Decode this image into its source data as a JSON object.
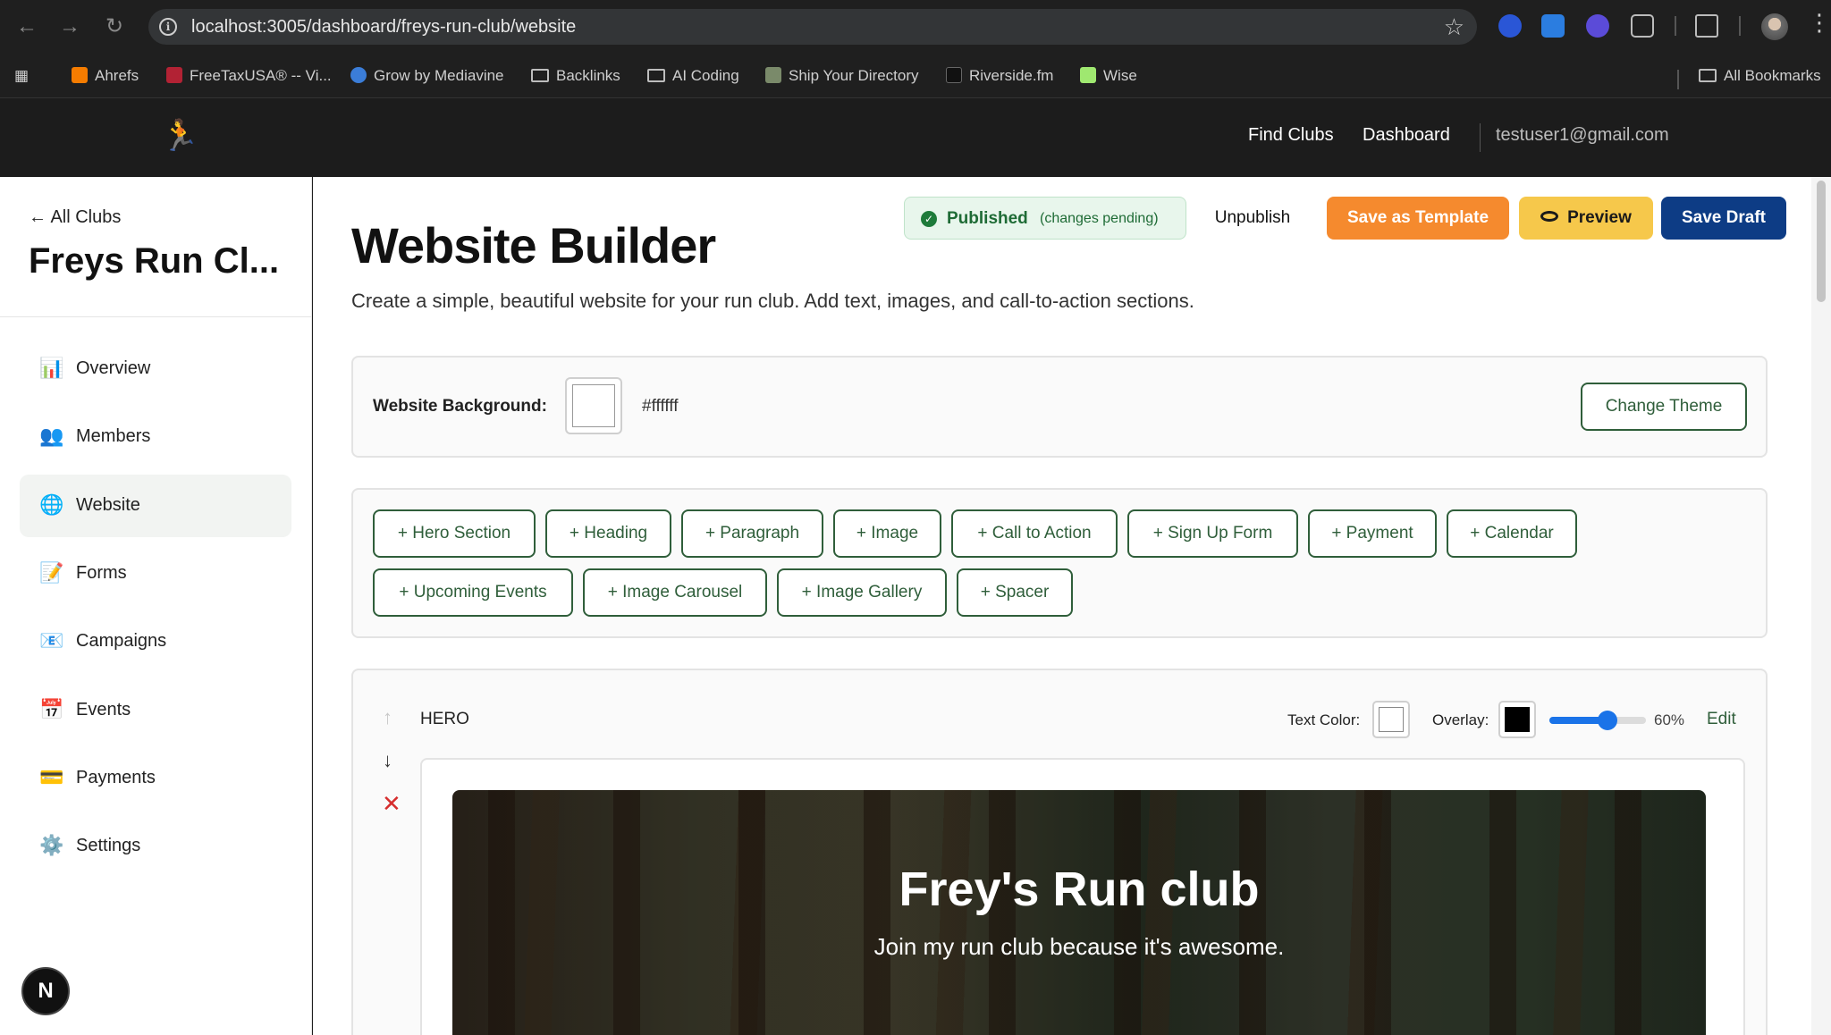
{
  "browser": {
    "url": "localhost:3005/dashboard/freys-run-club/website",
    "bookmarks": [
      "Ahrefs",
      "FreeTaxUSA® -- Vi...",
      "Grow by Mediavine",
      "Backlinks",
      "AI Coding",
      "Ship Your Directory",
      "Riverside.fm",
      "Wise"
    ],
    "all_bookmarks": "All Bookmarks"
  },
  "header": {
    "nav": [
      "Find Clubs",
      "Dashboard"
    ],
    "user_email": "testuser1@gmail.com"
  },
  "sidebar": {
    "back_label": "← All Clubs",
    "club_name": "Freys Run Cl...",
    "items": [
      {
        "label": "Overview",
        "icon": "📊"
      },
      {
        "label": "Members",
        "icon": "👥"
      },
      {
        "label": "Website",
        "icon": "🌐"
      },
      {
        "label": "Forms",
        "icon": "📝"
      },
      {
        "label": "Campaigns",
        "icon": "📧"
      },
      {
        "label": "Events",
        "icon": "📅"
      },
      {
        "label": "Payments",
        "icon": "💳"
      },
      {
        "label": "Settings",
        "icon": "⚙️"
      }
    ],
    "active": "Website",
    "badge": "N"
  },
  "main": {
    "title": "Website Builder",
    "description": "Create a simple, beautiful website for your run club. Add text, images, and call-to-action sections.",
    "status": "Published",
    "status_sub": "(changes pending)",
    "actions": {
      "unpublish": "Unpublish",
      "save_template": "Save as Template",
      "preview": "Preview",
      "save_draft": "Save Draft"
    },
    "background": {
      "label": "Website Background:",
      "value": "#ffffff",
      "change_theme": "Change Theme"
    },
    "add_blocks": [
      "+ Hero Section",
      "+ Heading",
      "+ Paragraph",
      "+ Image",
      "+ Call to Action",
      "+ Sign Up Form",
      "+ Payment",
      "+ Calendar",
      "+ Upcoming Events",
      "+ Image Carousel",
      "+ Image Gallery",
      "+ Spacer"
    ],
    "hero": {
      "label": "HERO",
      "text_color_label": "Text Color:",
      "text_color": "#ffffff",
      "overlay_label": "Overlay:",
      "overlay_color": "#000000",
      "overlay_percent": "60%",
      "overlay_value": 60,
      "edit": "Edit",
      "title": "Frey's Run club",
      "subtitle": "Join my run club because it's awesome."
    }
  },
  "colors": {
    "accent_green": "#2f5e3a",
    "orange": "#f58a2e",
    "yellow": "#f6c84b",
    "navy": "#0d3c85"
  }
}
